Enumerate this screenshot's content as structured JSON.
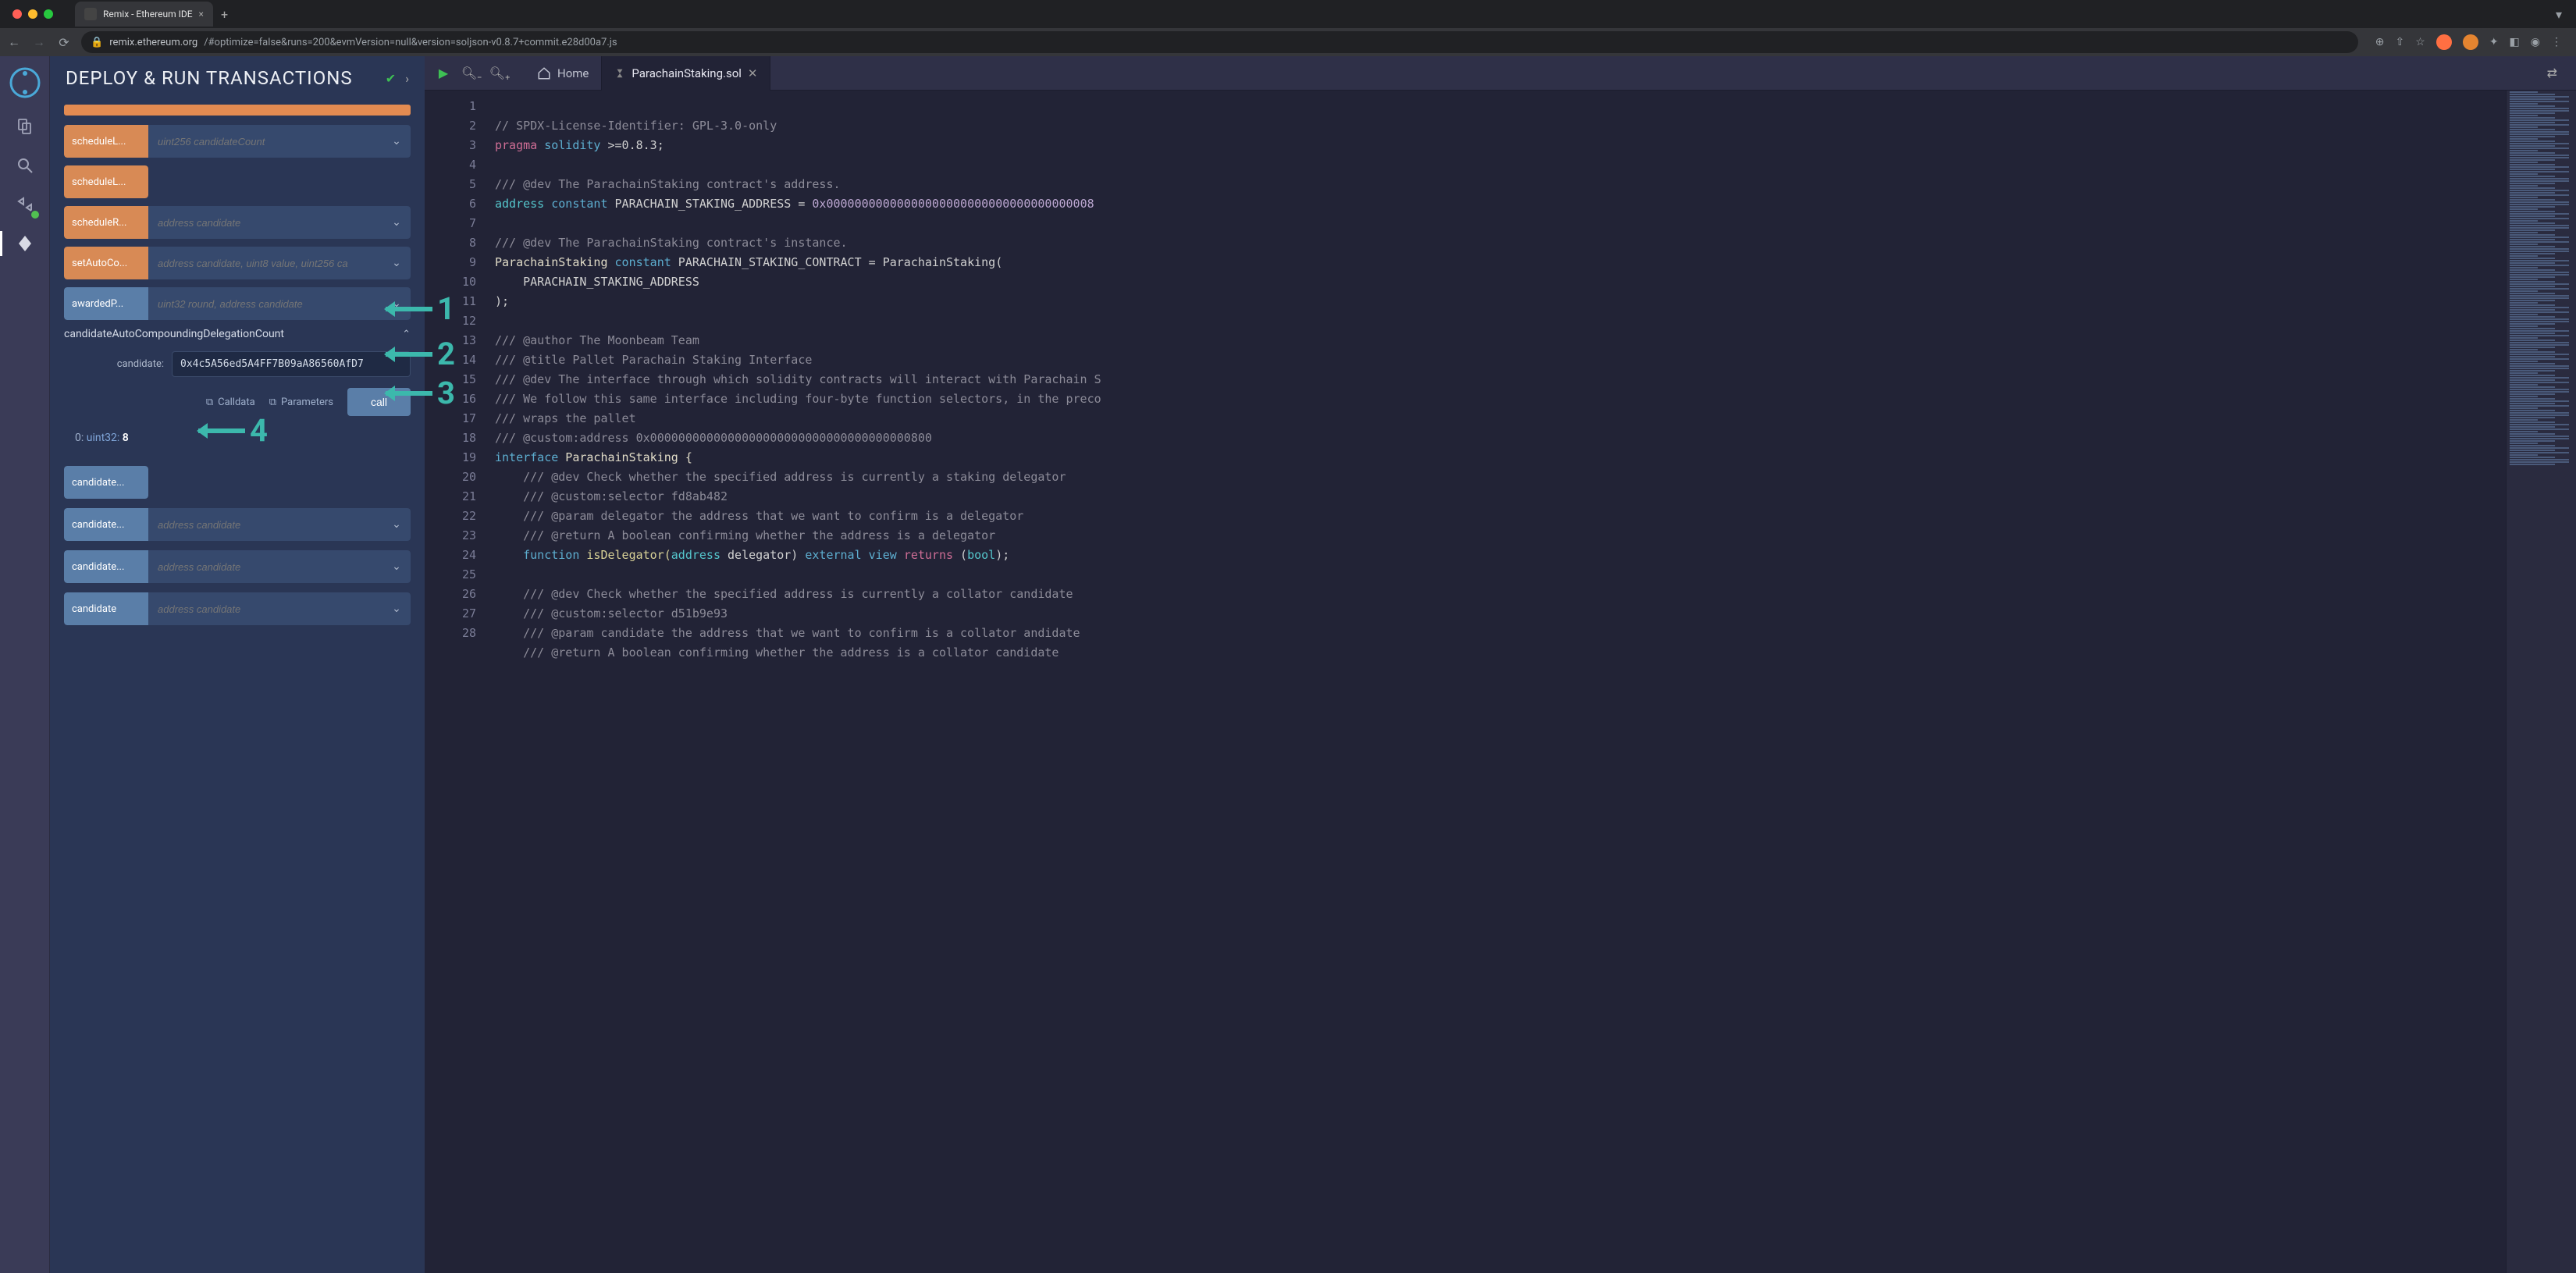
{
  "browser": {
    "tab_title": "Remix - Ethereum IDE",
    "url_host": "remix.ethereum.org",
    "url_path": "/#optimize=false&runs=200&evmVersion=null&version=soljson-v0.8.7+commit.e28d00a7.js"
  },
  "panel": {
    "title": "DEPLOY & RUN TRANSACTIONS",
    "functions": {
      "scheduleL1": {
        "label": "scheduleL...",
        "placeholder": "uint256 candidateCount"
      },
      "scheduleL2": {
        "label": "scheduleL..."
      },
      "scheduleR": {
        "label": "scheduleR...",
        "placeholder": "address candidate"
      },
      "setAuto": {
        "label": "setAutoCo...",
        "placeholder": "address candidate, uint8 value, uint256 ca"
      },
      "awarded": {
        "label": "awardedP...",
        "placeholder": "uint32 round, address candidate"
      }
    },
    "expanded": {
      "name": "candidateAutoCompoundingDelegationCount",
      "param_label": "candidate:",
      "param_value": "0x4c5A56ed5A4FF7B09aA86560AfD7",
      "calldata_label": "Calldata",
      "parameters_label": "Parameters",
      "call_label": "call",
      "result_index": "0:",
      "result_type": "uint32:",
      "result_value": "8"
    },
    "blue_rows": {
      "r1": {
        "label": "candidate..."
      },
      "r2": {
        "label": "candidate...",
        "placeholder": "address candidate"
      },
      "r3": {
        "label": "candidate...",
        "placeholder": "address candidate"
      },
      "r4": {
        "label": "candidate",
        "placeholder": "address candidate"
      }
    }
  },
  "tabs": {
    "home": "Home",
    "file": "ParachainStaking.sol"
  },
  "code": {
    "l1": "// SPDX-License-Identifier: GPL-3.0-only",
    "l2a": "pragma",
    "l2b": " solidity ",
    "l2c": ">=0.8.3;",
    "l4": "/// @dev The ParachainStaking contract's address.",
    "l5a": "address",
    "l5b": " constant",
    "l5c": " PARACHAIN_STAKING_ADDRESS = ",
    "l5d": "0x00000000000000000000000000000000000008",
    "l7": "/// @dev The ParachainStaking contract's instance.",
    "l8a": "ParachainStaking ",
    "l8b": "constant",
    "l8c": " PARACHAIN_STAKING_CONTRACT = ParachainStaking(",
    "l9": "    PARACHAIN_STAKING_ADDRESS",
    "l10": ");",
    "l12": "/// @author The Moonbeam Team",
    "l13": "/// @title Pallet Parachain Staking Interface",
    "l14": "/// @dev The interface through which solidity contracts will interact with Parachain S",
    "l15": "/// We follow this same interface including four-byte function selectors, in the preco",
    "l16": "/// wraps the pallet",
    "l17": "/// @custom:address 0x0000000000000000000000000000000000000800",
    "l18a": "interface",
    "l18b": " ParachainStaking {",
    "l19": "    /// @dev Check whether the specified address is currently a staking delegator",
    "l20": "    /// @custom:selector fd8ab482",
    "l21": "    /// @param delegator the address that we want to confirm is a delegator",
    "l22": "    /// @return A boolean confirming whether the address is a delegator",
    "l23a": "    function",
    "l23b": " isDelegator(",
    "l23c": "address",
    "l23d": " delegator) ",
    "l23e": "external",
    "l23f": " view ",
    "l23g": "returns",
    "l23h": " (",
    "l23i": "bool",
    "l23j": ");",
    "l25": "    /// @dev Check whether the specified address is currently a collator candidate",
    "l26": "    /// @custom:selector d51b9e93",
    "l27": "    /// @param candidate the address that we want to confirm is a collator andidate",
    "l28": "    /// @return A boolean confirming whether the address is a collator candidate"
  },
  "annotations": {
    "a1": "1",
    "a2": "2",
    "a3": "3",
    "a4": "4"
  }
}
